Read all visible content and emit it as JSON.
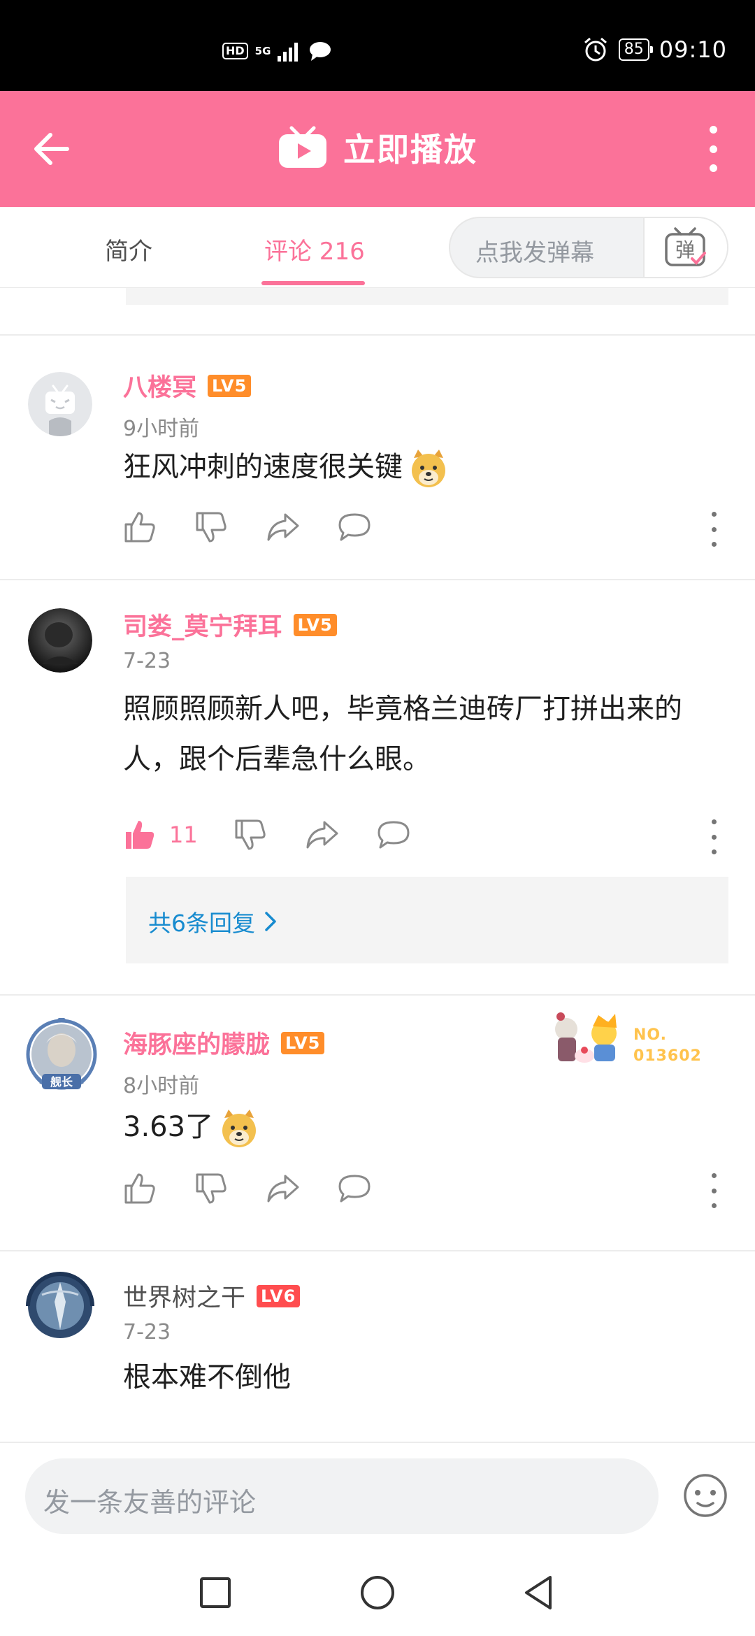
{
  "status_bar": {
    "hd": "HD",
    "network": "5G",
    "battery": "85",
    "time": "09:10"
  },
  "app_bar": {
    "title": "立即播放",
    "brand_color": "#fb7299"
  },
  "tabs": {
    "intro": "简介",
    "comments": "评论 216",
    "danmaku_placeholder": "点我发弹幕",
    "danmaku_button": "弹"
  },
  "comments": [
    {
      "username": "八楼冥",
      "level": "LV5",
      "time": "9小时前",
      "text": "狂风冲刺的速度很关键",
      "emoji": "doge-emoji"
    },
    {
      "username": "司娄_莫宁拜耳",
      "level": "LV5",
      "time": "7-23",
      "text": "照顾照顾新人吧，毕竟格兰迪砖厂打拼出来的人，跟个后辈急什么眼。",
      "likes": "11",
      "replies_label": "共6条回复"
    },
    {
      "username": "海豚座的朦胧",
      "level": "LV5",
      "avatar_label": "舰长",
      "time": "8小时前",
      "text": "3.63了",
      "emoji": "doge-emoji",
      "badge_line1": "NO.",
      "badge_line2": "013602"
    },
    {
      "username": "世界树之干",
      "level": "LV6",
      "time": "7-23",
      "text": "根本难不倒他"
    }
  ],
  "comment_input": {
    "placeholder": "发一条友善的评论"
  },
  "icons": {
    "back": "arrow-left-icon",
    "tv": "tv-play-icon",
    "more": "more-vertical-icon",
    "like": "thumb-up-icon",
    "dislike": "thumb-down-icon",
    "share": "share-icon",
    "reply": "comment-bubble-icon",
    "emoji": "emoji-face-icon"
  }
}
